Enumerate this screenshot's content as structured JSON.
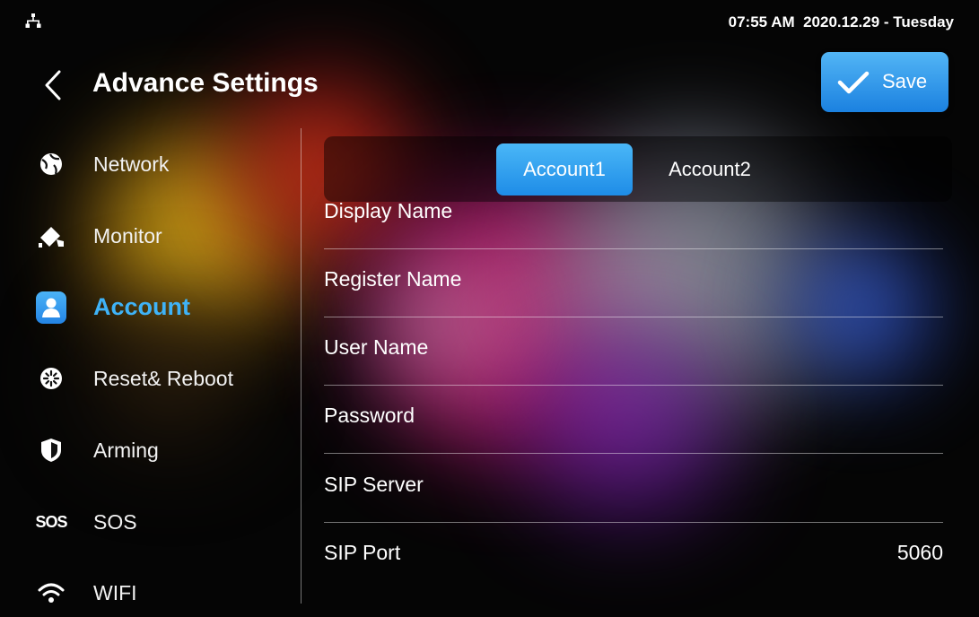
{
  "status_bar": {
    "icon": "network-status-icon",
    "clock": "07:55 AM  2020.12.29 - Tuesday"
  },
  "header": {
    "title": "Advance Settings",
    "back_icon": "chevron-left-icon",
    "save_label": "Save",
    "save_icon": "check-icon"
  },
  "sidebar": {
    "items": [
      {
        "label": "Network",
        "icon": "network-globe-icon",
        "active": false
      },
      {
        "label": "Monitor",
        "icon": "camera-icon",
        "active": false
      },
      {
        "label": "Account",
        "icon": "user-icon",
        "active": true
      },
      {
        "label": "Reset& Reboot",
        "icon": "reset-icon",
        "active": false
      },
      {
        "label": "Arming",
        "icon": "shield-icon",
        "active": false
      },
      {
        "label": "SOS",
        "icon": "sos-icon",
        "icon_text": "SOS",
        "active": false
      },
      {
        "label": "WIFI",
        "icon": "wifi-icon",
        "active": false
      }
    ]
  },
  "tabs": [
    {
      "label": "Account1",
      "selected": true
    },
    {
      "label": "Account2",
      "selected": false
    }
  ],
  "fields": [
    {
      "label": "Display Name",
      "value": ""
    },
    {
      "label": "Register Name",
      "value": ""
    },
    {
      "label": "User Name",
      "value": ""
    },
    {
      "label": "Password",
      "value": ""
    },
    {
      "label": "SIP Server",
      "value": ""
    },
    {
      "label": "SIP Port",
      "value": "5060"
    }
  ],
  "colors": {
    "accent": "#2E9AF0",
    "active_text": "#3FB3F7",
    "background": "#050505"
  }
}
